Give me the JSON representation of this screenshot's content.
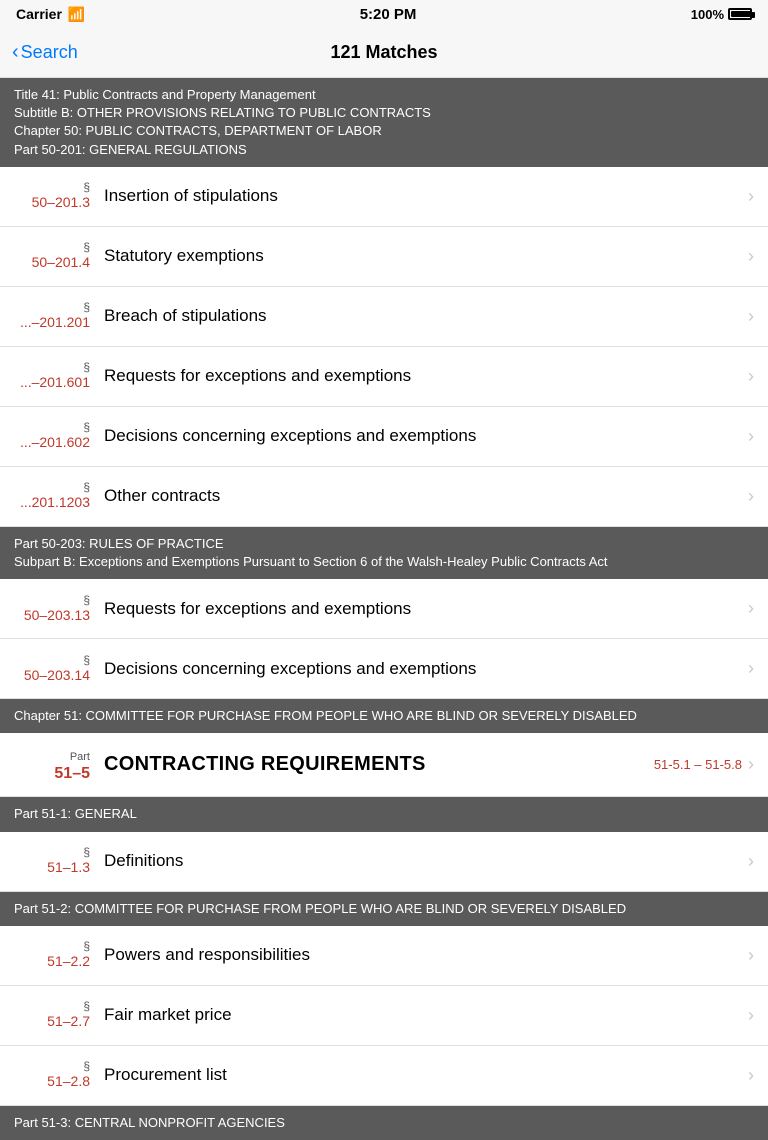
{
  "statusBar": {
    "carrier": "Carrier",
    "wifi": "📶",
    "time": "5:20 PM",
    "battery": "100%"
  },
  "nav": {
    "back": "Search",
    "title": "121 Matches"
  },
  "sections": [
    {
      "type": "header",
      "lines": [
        "Title 41: Public Contracts and Property Management",
        "Subtitle B: OTHER PROVISIONS RELATING TO PUBLIC CONTRACTS",
        "Chapter 50: PUBLIC CONTRACTS, DEPARTMENT OF LABOR",
        "Part 50-201: GENERAL REGULATIONS"
      ]
    },
    {
      "type": "item",
      "symbol": "§",
      "number": "50–201.3",
      "title": "Insertion of stipulations"
    },
    {
      "type": "item",
      "symbol": "§",
      "number": "50–201.4",
      "title": "Statutory exemptions"
    },
    {
      "type": "item",
      "symbol": "§",
      "number": "...–201.201",
      "title": "Breach of stipulations"
    },
    {
      "type": "item",
      "symbol": "§",
      "number": "...–201.601",
      "title": "Requests for exceptions and exemptions"
    },
    {
      "type": "item",
      "symbol": "§",
      "number": "...–201.602",
      "title": "Decisions concerning exceptions and exemptions"
    },
    {
      "type": "item",
      "symbol": "§",
      "number": "...201.1203",
      "title": "Other contracts"
    },
    {
      "type": "header",
      "lines": [
        "Part 50-203: RULES OF PRACTICE",
        "Subpart B: Exceptions and Exemptions Pursuant to Section 6 of the Walsh-Healey Public Contracts Act"
      ]
    },
    {
      "type": "item",
      "symbol": "§",
      "number": "50–203.13",
      "title": "Requests for exceptions and exemptions"
    },
    {
      "type": "item",
      "symbol": "§",
      "number": "50–203.14",
      "title": "Decisions concerning exceptions and exemptions"
    },
    {
      "type": "header",
      "lines": [
        "Chapter 51: COMMITTEE FOR PURCHASE FROM PEOPLE WHO ARE BLIND OR SEVERELY DISABLED"
      ]
    },
    {
      "type": "part",
      "partLabel": "Part",
      "partNumber": "51–5",
      "title": "CONTRACTING REQUIREMENTS",
      "range": "51-5.1 – 51-5.8"
    },
    {
      "type": "header",
      "lines": [
        "Part 51-1: GENERAL"
      ]
    },
    {
      "type": "item",
      "symbol": "§",
      "number": "51–1.3",
      "title": "Definitions"
    },
    {
      "type": "header",
      "lines": [
        "Part 51-2: COMMITTEE FOR PURCHASE FROM PEOPLE WHO ARE BLIND OR SEVERELY DISABLED"
      ]
    },
    {
      "type": "item",
      "symbol": "§",
      "number": "51–2.2",
      "title": "Powers and responsibilities"
    },
    {
      "type": "item",
      "symbol": "§",
      "number": "51–2.7",
      "title": "Fair market price"
    },
    {
      "type": "item",
      "symbol": "§",
      "number": "51–2.8",
      "title": "Procurement list"
    },
    {
      "type": "header",
      "lines": [
        "Part 51-3: CENTRAL NONPROFIT AGENCIES"
      ]
    }
  ]
}
